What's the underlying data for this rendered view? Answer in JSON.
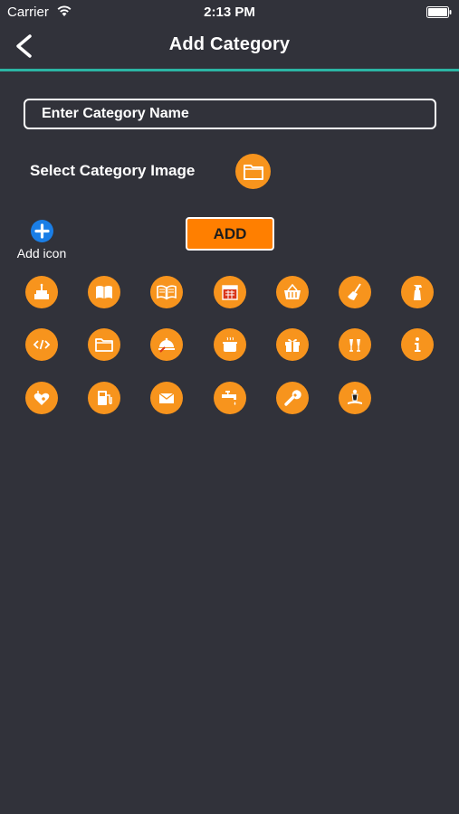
{
  "status_bar": {
    "carrier": "Carrier",
    "time": "2:13 PM"
  },
  "nav": {
    "title": "Add Category"
  },
  "form": {
    "name_placeholder": "Enter Category Name",
    "select_image_label": "Select Category Image",
    "add_icon_label": "Add icon",
    "add_button_label": "ADD"
  },
  "colors": {
    "background": "#31323a",
    "accent_divider": "#2bb5a4",
    "icon_orange": "#f7941d",
    "add_button": "#ff7f00",
    "add_icon_blue": "#1a7ee6"
  },
  "icons": [
    "cake-icon",
    "book-icon",
    "open-book-icon",
    "calendar-icon",
    "basket-icon",
    "broom-icon",
    "spray-bottle-icon",
    "code-icon",
    "folder-icon",
    "food-tray-icon",
    "cooking-pot-icon",
    "gift-icon",
    "cheers-icon",
    "info-icon",
    "heart-stethoscope-icon",
    "fuel-pump-icon",
    "mail-icon",
    "water-tap-icon",
    "wrench-icon",
    "person-icon"
  ]
}
